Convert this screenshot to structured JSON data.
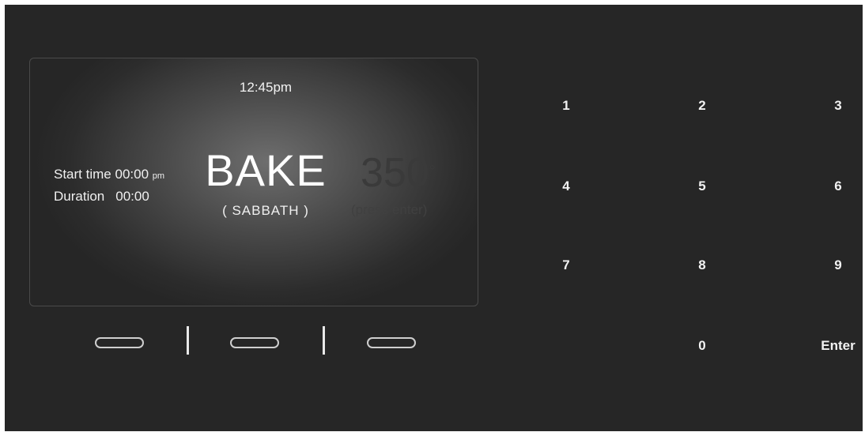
{
  "display": {
    "clock": "12:45pm",
    "start_time_label": "Start time",
    "start_time_value": "00:00",
    "start_time_unit": "pm",
    "duration_label": "Duration",
    "duration_value": "00:00",
    "mode": "BAKE",
    "submode": "( SABBATH )",
    "temperature": "350",
    "temperature_unit": "°",
    "hint": "(press enter)"
  },
  "softkeys": [
    "left-softkey",
    "middle-softkey",
    "right-softkey"
  ],
  "keypad": {
    "k1": "1",
    "k2": "2",
    "k3": "3",
    "k4": "4",
    "k5": "5",
    "k6": "6",
    "k7": "7",
    "k8": "8",
    "k9": "9",
    "k0": "0",
    "enter": "Enter"
  },
  "colors": {
    "panel_background": "#262626",
    "text": "#f2f2f2",
    "dimmed_text": "#3a3a3a"
  }
}
